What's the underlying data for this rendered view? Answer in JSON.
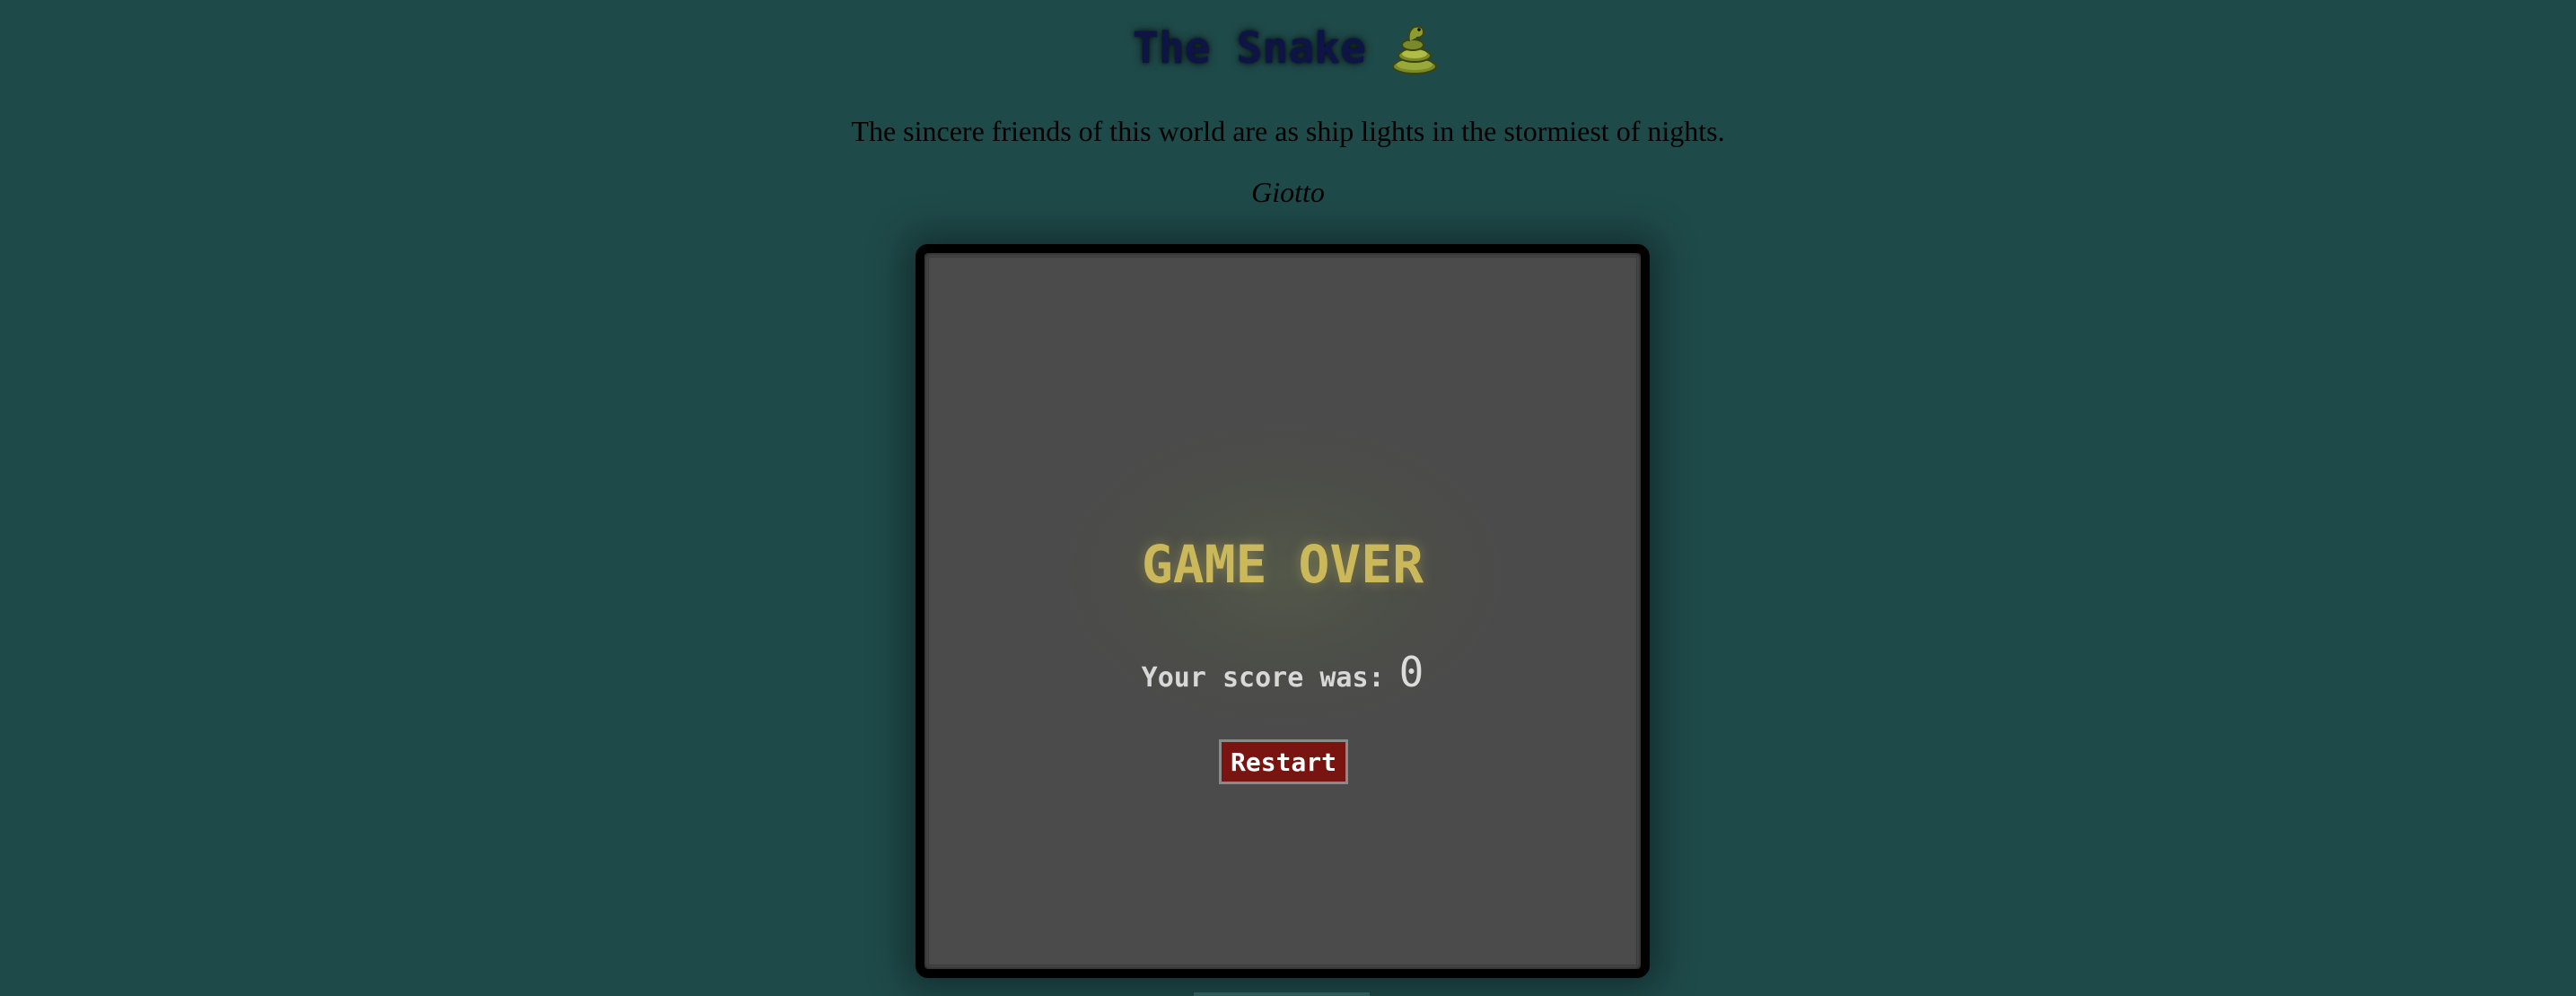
{
  "header": {
    "title": "The Snake",
    "icon": "snake-emoji-icon"
  },
  "quote": {
    "text": "The sincere friends of this world are as ship lights in the stormiest of nights.",
    "author": "Giotto"
  },
  "game": {
    "status": "GAME OVER",
    "score_label": "Your score was:",
    "score_value": "0",
    "restart_label": "Restart"
  },
  "colors": {
    "background": "#1f4a4a",
    "board": "#4b4b4b",
    "board_border": "#000000",
    "title": "#0f1446",
    "game_over": "#cbb85a",
    "restart_button": "#7a1410"
  }
}
